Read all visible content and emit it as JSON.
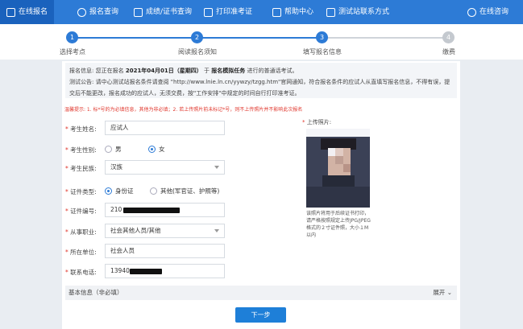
{
  "nav": {
    "items": [
      {
        "label": "在线报名",
        "icon": "edit-icon",
        "active": true
      },
      {
        "label": "报名查询",
        "icon": "search-icon"
      },
      {
        "label": "成绩/证书查询",
        "icon": "certificate-icon"
      },
      {
        "label": "打印准考证",
        "icon": "printer-icon"
      },
      {
        "label": "帮助中心",
        "icon": "help-icon"
      },
      {
        "label": "测试站联系方式",
        "icon": "phone-icon"
      },
      {
        "label": "在线咨询",
        "icon": "chat-icon"
      }
    ],
    "color": "#2d7bd6"
  },
  "steps": [
    {
      "num": "1",
      "label": "选择考点",
      "state": "done"
    },
    {
      "num": "2",
      "label": "阅读报名须知",
      "state": "done"
    },
    {
      "num": "3",
      "label": "填写报名信息",
      "state": "active"
    },
    {
      "num": "4",
      "label": "缴费",
      "state": "todo"
    }
  ],
  "notice": {
    "info_prefix": "报名信息: 您正在报名",
    "info_date": "2021年04月01日（星期四）",
    "info_mid": "于",
    "info_task": "报名模拟任务",
    "info_suffix": "进行的普通话考试。",
    "bulletin": "测试公告: 请中心测试站报名条件请查阅 \"http://www.lnie.ln.cn/yywzy/tzgg.htm\"官网通知，符合报名条件的应试人从直填写报名信息，不得有误，提交后不能更改，报名成功的应试人，无须交费，按\"工作安排\"中规定的时间自行打印准考证。"
  },
  "warning": "温馨提示: 1. 标*号的为必填信息，其他为非必填；2. 若上传照片前未标记*号，则不上传照片并不影响此次报名",
  "form": {
    "name_label": "考生姓名:",
    "name_value": "应试人",
    "gender_label": "考生性别:",
    "gender_male": "男",
    "gender_female": "女",
    "gender_selected": "女",
    "ethnicity_label": "考生民族:",
    "ethnicity_value": "汉族",
    "id_type_label": "证件类型:",
    "id_type_option1": "身份证",
    "id_type_option2": "其他(军官证、护照等)",
    "id_type_selected": "身份证",
    "id_number_label": "证件编号:",
    "id_number_value": "210",
    "occupation_label": "从事职业:",
    "occupation_value": "社会其他人员/其他",
    "employer_label": "所在单位:",
    "employer_value": "社会人员",
    "phone_label": "联系电话:",
    "phone_value": "13940"
  },
  "photo": {
    "label": "上传照片:",
    "note": "该照片将用于后续证书打印，请严格按照规定上传JPG/JPEG格式的２寸证件照，大小１M以内"
  },
  "basic_info": {
    "title": "基本信息（非必填）",
    "expand": "展开"
  },
  "next_button": "下一步"
}
